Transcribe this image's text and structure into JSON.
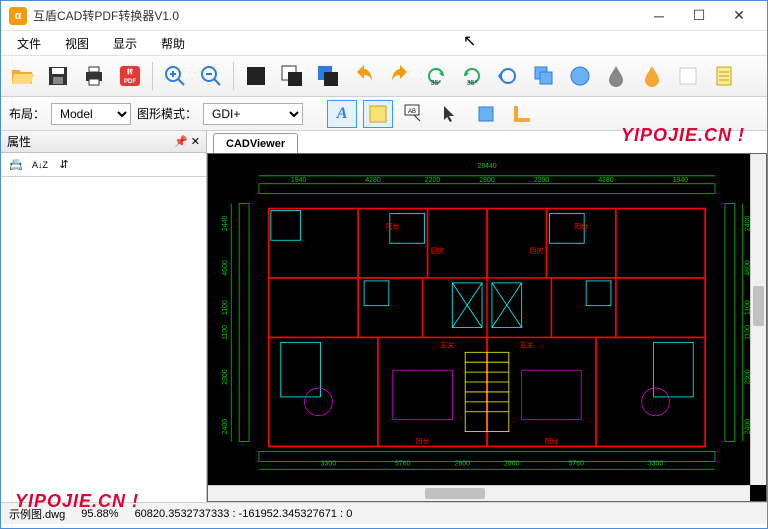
{
  "window": {
    "title": "互盾CAD转PDF转换器V1.0",
    "app_icon_text": "α"
  },
  "menu": {
    "items": [
      "文件",
      "视图",
      "显示",
      "帮助"
    ]
  },
  "toolbar2": {
    "layout_label": "布局：",
    "layout_value": "Model",
    "mode_label": "图形模式：",
    "mode_value": "GDI+"
  },
  "properties": {
    "title": "属性",
    "sort_cat": "📇",
    "sort_az": "A↓Z",
    "sort3": "⇵"
  },
  "tabs": {
    "viewer": "CADViewer"
  },
  "status": {
    "filename": "示例图.dwg",
    "zoom": "95.88%",
    "coords": "60820.3532737333 : -161952.345327671 : 0"
  },
  "watermark": "YIPOJIE.CN !",
  "drawing_labels": {
    "top_dim": "28440",
    "sub_dims": [
      "1940",
      "4280",
      "2200",
      "2800",
      "2200",
      "4280",
      "1940"
    ],
    "left_dims": [
      "2440",
      "4600",
      "1100",
      "1100",
      "2300",
      "2400"
    ],
    "right_dims": [
      "2400",
      "4600",
      "1100",
      "1100",
      "2300",
      "2400"
    ],
    "bottom_dims": [
      "3300",
      "5760",
      "2800",
      "2800",
      "5760",
      "3300"
    ],
    "room_balcony": "阳台",
    "room_kitchen": "厨房",
    "room_entry": "玄关"
  }
}
